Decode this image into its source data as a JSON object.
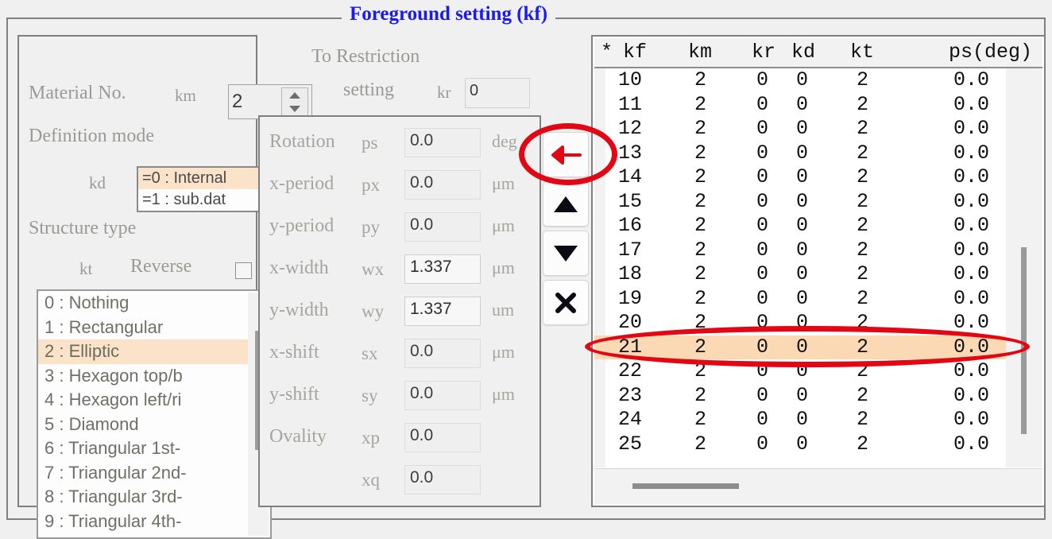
{
  "window": {
    "group_title": "Foreground setting (kf)"
  },
  "left_panel": {
    "material_label": "Material No.",
    "material_var": "km",
    "material_value": "2",
    "restriction_label_line1": "To Restriction",
    "restriction_label_line2": "setting",
    "restriction_var": "kr",
    "restriction_value": "0",
    "definition_mode_label": "Definition mode",
    "definition_var": "kd",
    "definition_options": [
      "=0 : Internal",
      "=1 : sub.dat"
    ],
    "definition_selected_index": 0,
    "structure_type_label": "Structure type",
    "structure_var": "kt",
    "reverse_label": "Reverse",
    "reverse_checked": false,
    "structure_items": [
      "0 : Nothing",
      "1 : Rectangular",
      "2 : Elliptic",
      "3 : Hexagon top/b",
      "4 : Hexagon left/ri",
      "5 : Diamond",
      "6 : Triangular 1st-",
      "7 : Triangular 2nd-",
      "8 : Triangular 3rd-",
      "9 : Triangular 4th-"
    ],
    "structure_selected_index": 2
  },
  "mid_panel": {
    "rows": [
      {
        "label": "Rotation",
        "var": "ps",
        "value": "0.0",
        "unit": "deg",
        "emph": false
      },
      {
        "label": "x-period",
        "var": "px",
        "value": "0.0",
        "unit": "μm",
        "emph": false
      },
      {
        "label": "y-period",
        "var": "py",
        "value": "0.0",
        "unit": "μm",
        "emph": false
      },
      {
        "label": "x-width",
        "var": "wx",
        "value": "1.337",
        "unit": "μm",
        "emph": true
      },
      {
        "label": "y-width",
        "var": "wy",
        "value": "1.337",
        "unit": "um",
        "emph": true
      },
      {
        "label": "x-shift",
        "var": "sx",
        "value": "0.0",
        "unit": "μm",
        "emph": false
      },
      {
        "label": "y-shift",
        "var": "sy",
        "value": "0.0",
        "unit": "μm",
        "emph": false
      },
      {
        "label": "Ovality",
        "var": "xp",
        "value": "0.0",
        "unit": "",
        "emph": false
      },
      {
        "label": "",
        "var": "xq",
        "value": "0.0",
        "unit": "",
        "emph": false
      }
    ]
  },
  "buttons": {
    "apply_left": "←",
    "move_up": "▲",
    "move_down": "▼",
    "delete": "✕",
    "icons": [
      "arrow-left-icon",
      "triangle-up-icon",
      "triangle-down-icon",
      "close-x-icon"
    ]
  },
  "table": {
    "headers": [
      "*",
      "kf",
      "km",
      "kr",
      "kd",
      "kt",
      "ps(deg)"
    ],
    "selected_kf": "21",
    "rows": [
      {
        "mark": "",
        "kf": "10",
        "km": "2",
        "kr": "0",
        "kd": "0",
        "kt": "2",
        "ps": "0.0"
      },
      {
        "mark": "",
        "kf": "11",
        "km": "2",
        "kr": "0",
        "kd": "0",
        "kt": "2",
        "ps": "0.0"
      },
      {
        "mark": "",
        "kf": "12",
        "km": "2",
        "kr": "0",
        "kd": "0",
        "kt": "2",
        "ps": "0.0"
      },
      {
        "mark": "",
        "kf": "13",
        "km": "2",
        "kr": "0",
        "kd": "0",
        "kt": "2",
        "ps": "0.0"
      },
      {
        "mark": "",
        "kf": "14",
        "km": "2",
        "kr": "0",
        "kd": "0",
        "kt": "2",
        "ps": "0.0"
      },
      {
        "mark": "",
        "kf": "15",
        "km": "2",
        "kr": "0",
        "kd": "0",
        "kt": "2",
        "ps": "0.0"
      },
      {
        "mark": "",
        "kf": "16",
        "km": "2",
        "kr": "0",
        "kd": "0",
        "kt": "2",
        "ps": "0.0"
      },
      {
        "mark": "",
        "kf": "17",
        "km": "2",
        "kr": "0",
        "kd": "0",
        "kt": "2",
        "ps": "0.0"
      },
      {
        "mark": "",
        "kf": "18",
        "km": "2",
        "kr": "0",
        "kd": "0",
        "kt": "2",
        "ps": "0.0"
      },
      {
        "mark": "",
        "kf": "19",
        "km": "2",
        "kr": "0",
        "kd": "0",
        "kt": "2",
        "ps": "0.0"
      },
      {
        "mark": "",
        "kf": "20",
        "km": "2",
        "kr": "0",
        "kd": "0",
        "kt": "2",
        "ps": "0.0"
      },
      {
        "mark": "",
        "kf": "21",
        "km": "2",
        "kr": "0",
        "kd": "0",
        "kt": "2",
        "ps": "0.0"
      },
      {
        "mark": "",
        "kf": "22",
        "km": "2",
        "kr": "0",
        "kd": "0",
        "kt": "2",
        "ps": "0.0"
      },
      {
        "mark": "",
        "kf": "23",
        "km": "2",
        "kr": "0",
        "kd": "0",
        "kt": "2",
        "ps": "0.0"
      },
      {
        "mark": "",
        "kf": "24",
        "km": "2",
        "kr": "0",
        "kd": "0",
        "kt": "2",
        "ps": "0.0"
      },
      {
        "mark": "",
        "kf": "25",
        "km": "2",
        "kr": "0",
        "kd": "0",
        "kt": "2",
        "ps": "0.0"
      }
    ]
  },
  "annotations": {
    "color": "#e30613",
    "highlight_row_kf": "21",
    "highlight_button": "arrow-left-icon"
  },
  "colors": {
    "title": "#1a1aee",
    "selection": "#fbe3c9",
    "table_selection": "#fbd9b4",
    "annotation": "#e30613",
    "label": "#a5a5a0"
  }
}
